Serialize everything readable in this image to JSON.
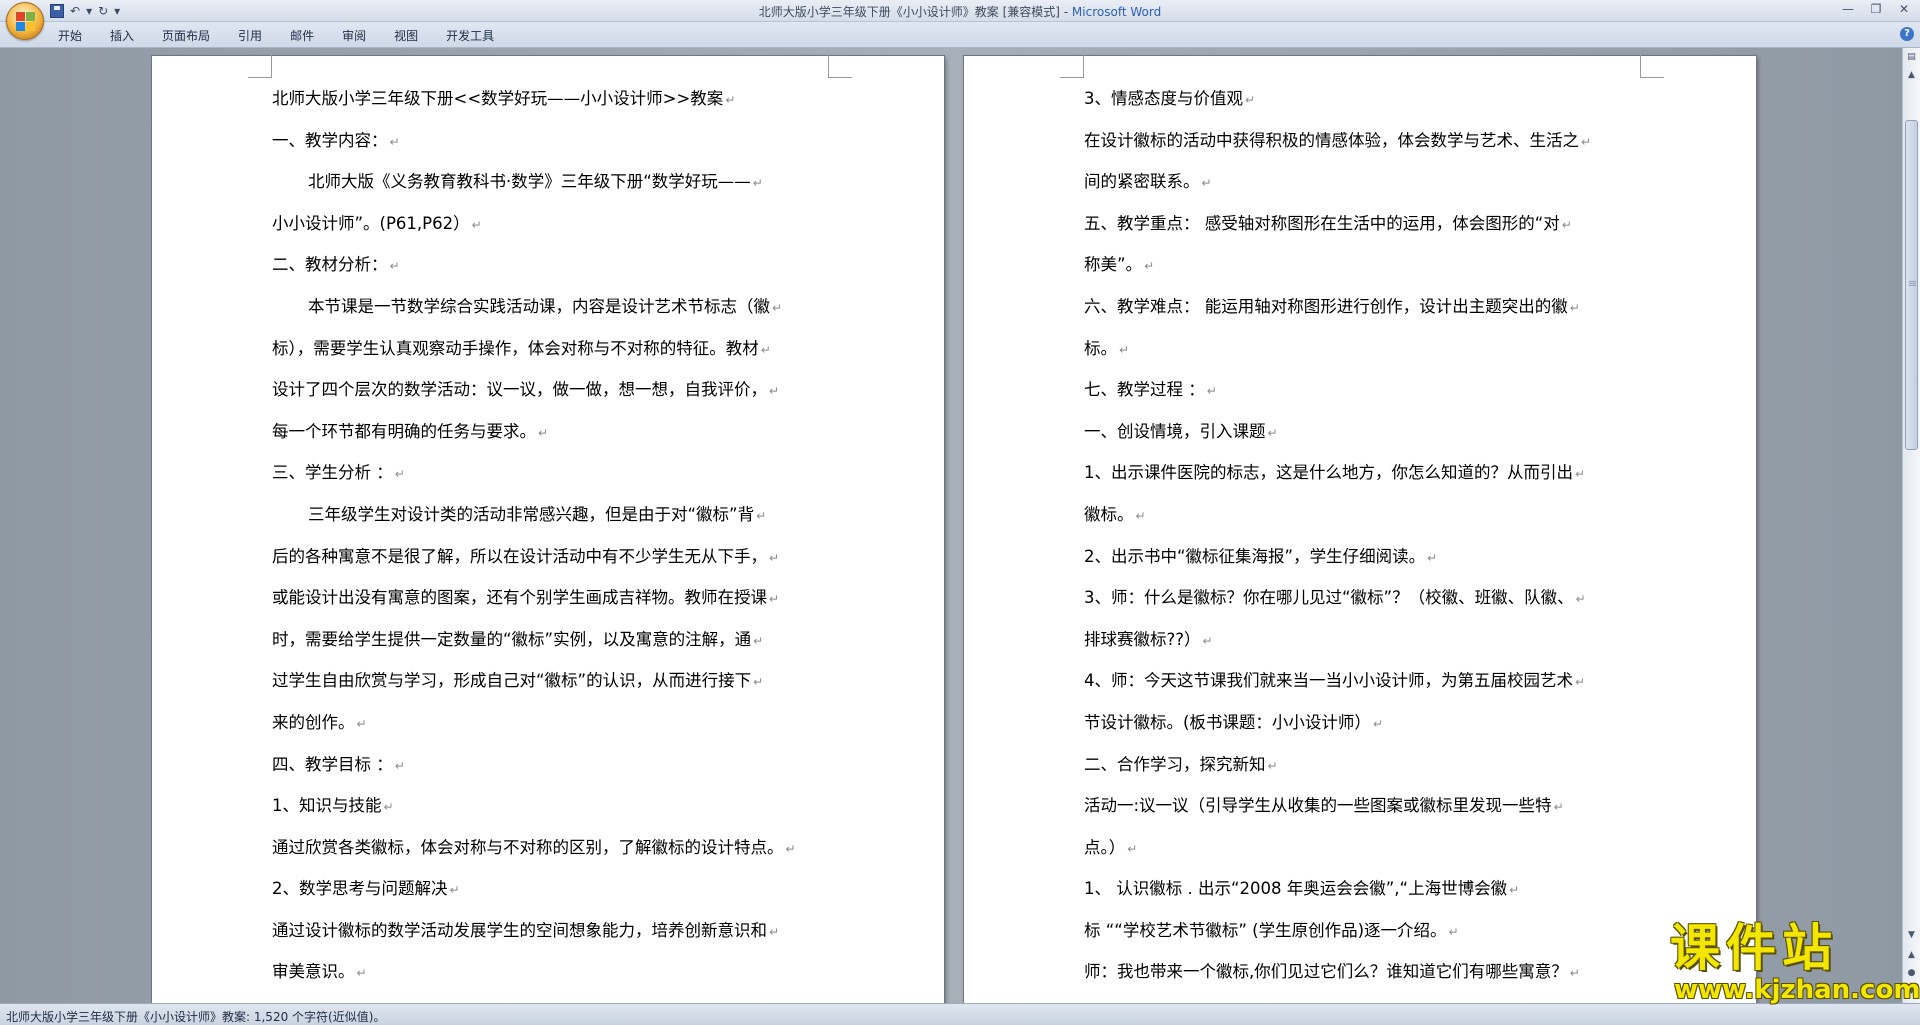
{
  "window": {
    "title": "北师大版小学三年级下册《小小设计师》教案 [兼容模式] - ",
    "app_name": "Microsoft Word"
  },
  "ribbon": {
    "tabs": [
      "开始",
      "插入",
      "页面布局",
      "引用",
      "邮件",
      "审阅",
      "视图",
      "开发工具"
    ]
  },
  "page_left": {
    "lines": [
      {
        "text": "北师大版小学三年级下册<<数学好玩——小小设计师>>教案",
        "indent": false
      },
      {
        "text": "一、教学内容：",
        "indent": false
      },
      {
        "text": "北师大版《义务教育教科书·数学》三年级下册“数学好玩——",
        "indent": true
      },
      {
        "text": "小小设计师”。(P61,P62）",
        "indent": false
      },
      {
        "text": "二、教材分析：",
        "indent": false
      },
      {
        "text": "本节课是一节数学综合实践活动课，内容是设计艺术节标志（徽",
        "indent": true
      },
      {
        "text": "标），需要学生认真观察动手操作，体会对称与不对称的特征。教材",
        "indent": false
      },
      {
        "text": "设计了四个层次的数学活动：议一议，做一做，想一想，自我评价，",
        "indent": false
      },
      {
        "text": "每一个环节都有明确的任务与要求。",
        "indent": false
      },
      {
        "text": "三、学生分析 ：",
        "indent": false
      },
      {
        "text": "三年级学生对设计类的活动非常感兴趣，但是由于对“徽标”背",
        "indent": true
      },
      {
        "text": "后的各种寓意不是很了解，所以在设计活动中有不少学生无从下手，",
        "indent": false
      },
      {
        "text": "或能设计出没有寓意的图案，还有个别学生画成吉祥物。教师在授课",
        "indent": false
      },
      {
        "text": "时，需要给学生提供一定数量的“徽标”实例，以及寓意的注解，通",
        "indent": false
      },
      {
        "text": "过学生自由欣赏与学习，形成自己对“徽标”的认识，从而进行接下",
        "indent": false
      },
      {
        "text": "来的创作。",
        "indent": false
      },
      {
        "text": "四、教学目标 ：",
        "indent": false
      },
      {
        "text": "1、知识与技能",
        "indent": false
      },
      {
        "text": "通过欣赏各类徽标，体会对称与不对称的区别，了解徽标的设计特点。",
        "indent": false
      },
      {
        "text": "2、数学思考与问题解决",
        "indent": false
      },
      {
        "text": "通过设计徽标的数学活动发展学生的空间想象能力，培养创新意识和",
        "indent": false
      },
      {
        "text": "审美意识。",
        "indent": false
      }
    ]
  },
  "page_right": {
    "lines": [
      {
        "text": "3、情感态度与价值观",
        "indent": false
      },
      {
        "text": "在设计徽标的活动中获得积极的情感体验，体会数学与艺术、生活之",
        "indent": false
      },
      {
        "text": "间的紧密联系。",
        "indent": false
      },
      {
        "text": "五、教学重点： 感受轴对称图形在生活中的运用，体会图形的“对",
        "indent": false
      },
      {
        "text": "称美”。",
        "indent": false
      },
      {
        "text": "六、教学难点： 能运用轴对称图形进行创作，设计出主题突出的徽",
        "indent": false
      },
      {
        "text": "标。",
        "indent": false
      },
      {
        "text": "七、教学过程 ：",
        "indent": false
      },
      {
        "text": "一、创设情境，引入课题",
        "indent": false
      },
      {
        "text": "1、出示课件医院的标志，这是什么地方，你怎么知道的？从而引出",
        "indent": false
      },
      {
        "text": "徽标。",
        "indent": false
      },
      {
        "text": "2、出示书中“徽标征集海报”，学生仔细阅读。",
        "indent": false
      },
      {
        "text": "3、师：什么是徽标？你在哪儿见过“徽标”？（校徽、班徽、队徽、",
        "indent": false
      },
      {
        "text": "排球赛徽标??）",
        "indent": false
      },
      {
        "text": "4、师：今天这节课我们就来当一当小小设计师，为第五届校园艺术",
        "indent": false
      },
      {
        "text": "节设计徽标。(板书课题：小小设计师）",
        "indent": false
      },
      {
        "text": "二、合作学习，探究新知",
        "indent": false
      },
      {
        "text": "活动一:议一议（引导学生从收集的一些图案或徽标里发现一些特",
        "indent": false
      },
      {
        "text": "点。）",
        "indent": false
      },
      {
        "text": "1、 认识徽标 . 出示“2008 年奥运会会徽”,“上海世博会徽",
        "indent": false
      },
      {
        "text": "标 ““学校艺术节徽标” (学生原创作品)逐一介绍。",
        "indent": false
      },
      {
        "text": "师：我也带来一个徽标,你们见过它们么？谁知道它们有哪些寓意？",
        "indent": false
      }
    ]
  },
  "status": {
    "text": "北师大版小学三年级下册《小小设计师》教案: 1,520 个字符(近似值)。"
  },
  "watermark": {
    "big": "课件站",
    "small": "www.kjzhan.com"
  },
  "icons": {
    "paragraph_mark": "↵"
  }
}
